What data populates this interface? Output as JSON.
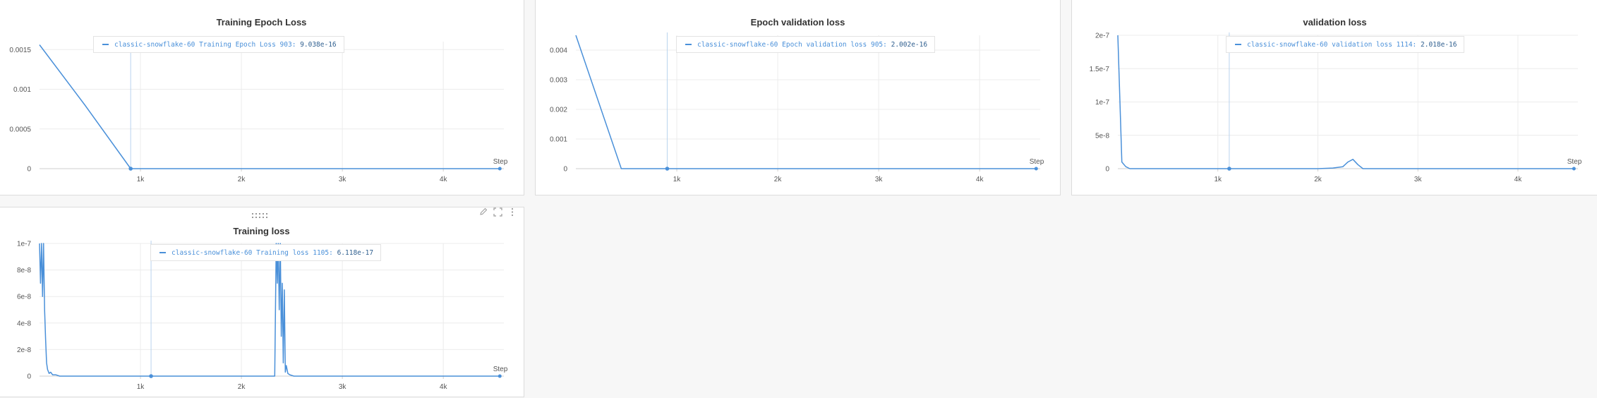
{
  "colors": {
    "series": "#4a90d9",
    "grid": "#ececec",
    "axis": "#cfcfcf"
  },
  "panels": [
    {
      "id": "p0",
      "title": "Training Epoch Loss",
      "legend": {
        "run": "classic-snowflake-60",
        "metric": "Training Epoch Loss",
        "step": "903:",
        "value": "9.038e-16"
      },
      "x_label": "Step"
    },
    {
      "id": "p1",
      "title": "Epoch validation loss",
      "legend": {
        "run": "classic-snowflake-60",
        "metric": "Epoch validation loss",
        "step": "905:",
        "value": "2.002e-16"
      },
      "x_label": "Step"
    },
    {
      "id": "p2",
      "title": "validation loss",
      "legend": {
        "run": "classic-snowflake-60",
        "metric": "validation loss",
        "step": "1114:",
        "value": "2.018e-16"
      },
      "x_label": "Step"
    },
    {
      "id": "p3",
      "title": "Training loss",
      "legend": {
        "run": "classic-snowflake-60",
        "metric": "Training loss",
        "step": "1105:",
        "value": "6.118e-17"
      },
      "x_label": "Step",
      "icons": [
        "drag-handle-icon",
        "edit-icon",
        "fullscreen-icon",
        "more-icon"
      ]
    }
  ],
  "chart_data": [
    {
      "type": "line",
      "title": "Training Epoch Loss",
      "xlabel": "Step",
      "ylabel": "",
      "xlim": [
        0,
        4600
      ],
      "ylim": [
        0,
        0.0016
      ],
      "x_ticks": [
        1000,
        2000,
        3000,
        4000
      ],
      "x_tick_labels": [
        "1k",
        "2k",
        "3k",
        "4k"
      ],
      "y_ticks": [
        0,
        0.0005,
        0.001,
        0.0015
      ],
      "y_tick_labels": [
        "0",
        "0.0005",
        "0.001",
        "0.0015"
      ],
      "hover_x": 903,
      "grid": true,
      "legend_position": "top-left",
      "series": [
        {
          "name": "classic-snowflake-60 Training Epoch Loss",
          "x": [
            0,
            450,
            903,
            1500,
            2500,
            3500,
            4560
          ],
          "y": [
            0.00156,
            0.0008,
            0,
            0,
            0,
            0,
            0
          ]
        }
      ]
    },
    {
      "type": "line",
      "title": "Epoch validation loss",
      "xlabel": "Step",
      "ylabel": "",
      "xlim": [
        0,
        4600
      ],
      "ylim": [
        0,
        0.0045
      ],
      "x_ticks": [
        1000,
        2000,
        3000,
        4000
      ],
      "x_tick_labels": [
        "1k",
        "2k",
        "3k",
        "4k"
      ],
      "y_ticks": [
        0,
        0.001,
        0.002,
        0.003,
        0.004
      ],
      "y_tick_labels": [
        "0",
        "0.001",
        "0.002",
        "0.003",
        "0.004"
      ],
      "hover_x": 905,
      "grid": true,
      "legend_position": "top-left",
      "series": [
        {
          "name": "classic-snowflake-60 Epoch validation loss",
          "x": [
            0,
            450,
            905,
            2000,
            3000,
            4000,
            4560
          ],
          "y": [
            0.0045,
            0,
            0,
            0,
            0,
            0,
            0
          ]
        }
      ]
    },
    {
      "type": "line",
      "title": "validation loss",
      "xlabel": "Step",
      "ylabel": "",
      "xlim": [
        0,
        4600
      ],
      "ylim": [
        0,
        2e-07
      ],
      "x_ticks": [
        1000,
        2000,
        3000,
        4000
      ],
      "x_tick_labels": [
        "1k",
        "2k",
        "3k",
        "4k"
      ],
      "y_ticks": [
        0,
        5e-08,
        1e-07,
        1.5e-07,
        2e-07
      ],
      "y_tick_labels": [
        "0",
        "5e-8",
        "1e-7",
        "1.5e-7",
        "2e-7"
      ],
      "hover_x": 1114,
      "grid": true,
      "legend_position": "top-left",
      "series": [
        {
          "name": "classic-snowflake-60 validation loss",
          "x": [
            0,
            40,
            80,
            120,
            200,
            1114,
            2000,
            2150,
            2250,
            2300,
            2350,
            2400,
            2450,
            2600,
            3500,
            4560
          ],
          "y": [
            2e-07,
            1e-08,
            3e-09,
            0,
            0,
            0,
            0,
            1e-09,
            3e-09,
            1e-08,
            1.4e-08,
            6e-09,
            0,
            0,
            0,
            0
          ]
        }
      ]
    },
    {
      "type": "line",
      "title": "Training loss",
      "xlabel": "Step",
      "ylabel": "",
      "xlim": [
        0,
        4600
      ],
      "ylim": [
        0,
        1e-07
      ],
      "x_ticks": [
        1000,
        2000,
        3000,
        4000
      ],
      "x_tick_labels": [
        "1k",
        "2k",
        "3k",
        "4k"
      ],
      "y_ticks": [
        0,
        2e-08,
        4e-08,
        6e-08,
        8e-08,
        1e-07
      ],
      "y_tick_labels": [
        "0",
        "2e-8",
        "4e-8",
        "6e-8",
        "8e-8",
        "1e-7"
      ],
      "hover_x": 1105,
      "grid": true,
      "legend_position": "top-left",
      "series": [
        {
          "name": "classic-snowflake-60 Training loss",
          "x": [
            0,
            10,
            20,
            30,
            40,
            50,
            60,
            70,
            80,
            95,
            110,
            130,
            160,
            200,
            300,
            1105,
            2000,
            2330,
            2345,
            2355,
            2365,
            2375,
            2385,
            2395,
            2405,
            2415,
            2425,
            2435,
            2445,
            2460,
            2480,
            2520,
            3000,
            4560
          ],
          "y": [
            1e-07,
            7e-08,
            1e-07,
            6e-08,
            1e-07,
            5e-08,
            2.8e-08,
            1e-08,
            5e-09,
            2e-09,
            3e-09,
            1e-09,
            1e-09,
            0,
            0,
            0,
            0,
            0,
            1e-07,
            7e-08,
            1e-07,
            5e-08,
            1e-07,
            3e-08,
            7e-08,
            1e-08,
            6.5e-08,
            3e-09,
            8e-09,
            2e-09,
            1e-09,
            0,
            0,
            0
          ]
        }
      ]
    }
  ]
}
